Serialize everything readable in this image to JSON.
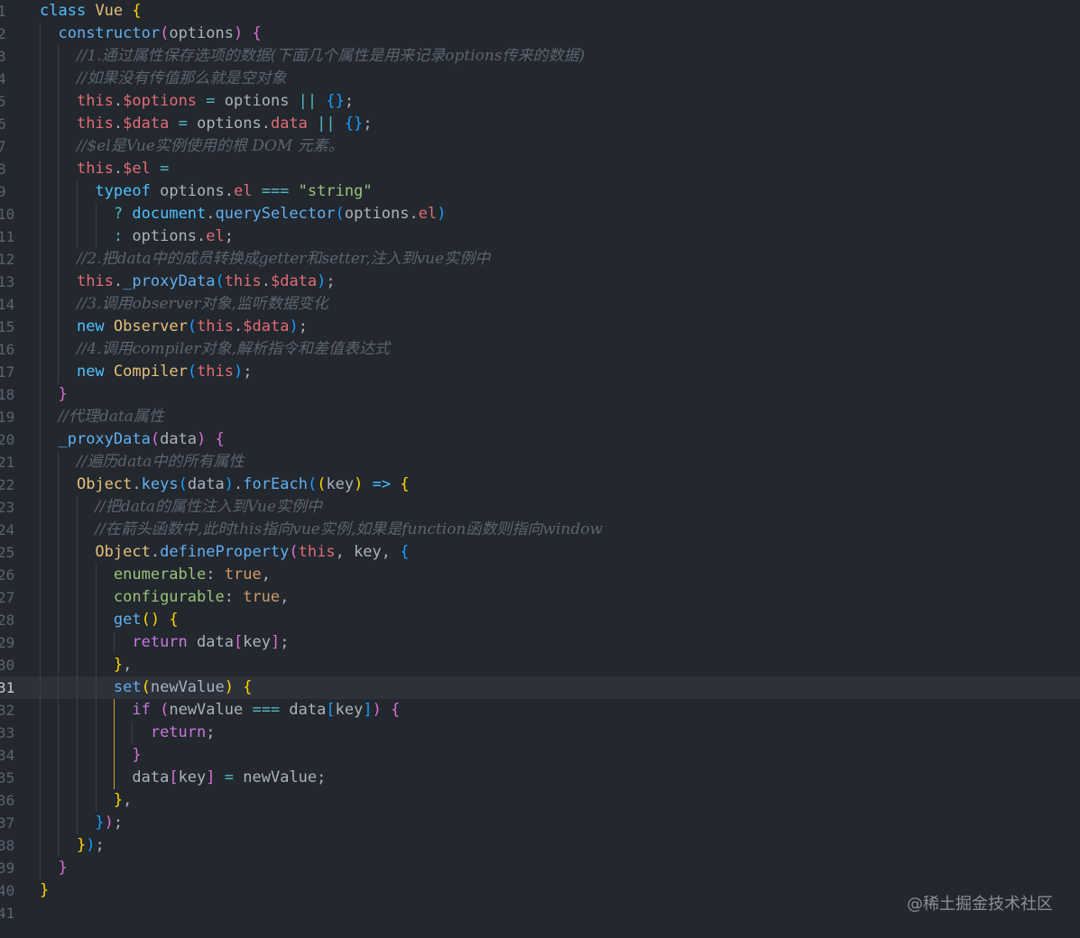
{
  "editor": {
    "line_numbers": [
      "1",
      "2",
      "3",
      "4",
      "5",
      "6",
      "7",
      "8",
      "9",
      "10",
      "11",
      "12",
      "13",
      "14",
      "15",
      "16",
      "17",
      "18",
      "19",
      "20",
      "21",
      "22",
      "23",
      "24",
      "25",
      "26",
      "27",
      "28",
      "29",
      "30",
      "31",
      "32",
      "33",
      "34",
      "35",
      "36",
      "37",
      "38",
      "39",
      "40",
      "41"
    ],
    "active_line": "31",
    "lines": [
      [
        [
          "kw",
          "class"
        ],
        [
          "pl",
          " "
        ],
        [
          "cls",
          "Vue"
        ],
        [
          "pl",
          " "
        ],
        [
          "b1",
          "{"
        ]
      ],
      [
        [
          "pl",
          "  "
        ],
        [
          "fn",
          "constructor"
        ],
        [
          "b2",
          "("
        ],
        [
          "pl",
          "options"
        ],
        [
          "b2",
          ")"
        ],
        [
          "pl",
          " "
        ],
        [
          "b2",
          "{"
        ]
      ],
      [
        [
          "pl",
          "    "
        ],
        [
          "cm",
          "//1.通过属性保存选项的数据(下面几个属性是用来记录options传来的数据)"
        ]
      ],
      [
        [
          "pl",
          "    "
        ],
        [
          "cm",
          "//如果没有传值那么就是空对象"
        ]
      ],
      [
        [
          "pl",
          "    "
        ],
        [
          "this",
          "this"
        ],
        [
          "pl",
          "."
        ],
        [
          "prop",
          "$options"
        ],
        [
          "pl",
          " "
        ],
        [
          "op",
          "="
        ],
        [
          "pl",
          " options "
        ],
        [
          "op",
          "||"
        ],
        [
          "pl",
          " "
        ],
        [
          "b3",
          "{}"
        ],
        [
          "pl",
          ";"
        ]
      ],
      [
        [
          "pl",
          "    "
        ],
        [
          "this",
          "this"
        ],
        [
          "pl",
          "."
        ],
        [
          "prop",
          "$data"
        ],
        [
          "pl",
          " "
        ],
        [
          "op",
          "="
        ],
        [
          "pl",
          " options."
        ],
        [
          "prop",
          "data"
        ],
        [
          "pl",
          " "
        ],
        [
          "op",
          "||"
        ],
        [
          "pl",
          " "
        ],
        [
          "b3",
          "{}"
        ],
        [
          "pl",
          ";"
        ]
      ],
      [
        [
          "pl",
          "    "
        ],
        [
          "cm",
          "//$el是Vue实例使用的根 DOM 元素。"
        ]
      ],
      [
        [
          "pl",
          "    "
        ],
        [
          "this",
          "this"
        ],
        [
          "pl",
          "."
        ],
        [
          "prop",
          "$el"
        ],
        [
          "pl",
          " "
        ],
        [
          "op",
          "="
        ]
      ],
      [
        [
          "pl",
          "      "
        ],
        [
          "kw",
          "typeof"
        ],
        [
          "pl",
          " options."
        ],
        [
          "prop",
          "el"
        ],
        [
          "pl",
          " "
        ],
        [
          "op",
          "==="
        ],
        [
          "pl",
          " "
        ],
        [
          "str",
          "\"string\""
        ]
      ],
      [
        [
          "pl",
          "        "
        ],
        [
          "op",
          "?"
        ],
        [
          "pl",
          " "
        ],
        [
          "kw",
          "document"
        ],
        [
          "pl",
          "."
        ],
        [
          "fn",
          "querySelector"
        ],
        [
          "b3",
          "("
        ],
        [
          "pl",
          "options."
        ],
        [
          "prop",
          "el"
        ],
        [
          "b3",
          ")"
        ]
      ],
      [
        [
          "pl",
          "        "
        ],
        [
          "op",
          ":"
        ],
        [
          "pl",
          " options."
        ],
        [
          "prop",
          "el"
        ],
        [
          "pl",
          ";"
        ]
      ],
      [
        [
          "pl",
          "    "
        ],
        [
          "cm",
          "//2.把data中的成员转换成getter和setter,注入到vue实例中"
        ]
      ],
      [
        [
          "pl",
          "    "
        ],
        [
          "this",
          "this"
        ],
        [
          "pl",
          "."
        ],
        [
          "fn",
          "_proxyData"
        ],
        [
          "b3",
          "("
        ],
        [
          "this",
          "this"
        ],
        [
          "pl",
          "."
        ],
        [
          "prop",
          "$data"
        ],
        [
          "b3",
          ")"
        ],
        [
          "pl",
          ";"
        ]
      ],
      [
        [
          "pl",
          "    "
        ],
        [
          "cm",
          "//3.调用observer对象,监听数据变化"
        ]
      ],
      [
        [
          "pl",
          "    "
        ],
        [
          "kw",
          "new"
        ],
        [
          "pl",
          " "
        ],
        [
          "cls",
          "Observer"
        ],
        [
          "b3",
          "("
        ],
        [
          "this",
          "this"
        ],
        [
          "pl",
          "."
        ],
        [
          "prop",
          "$data"
        ],
        [
          "b3",
          ")"
        ],
        [
          "pl",
          ";"
        ]
      ],
      [
        [
          "pl",
          "    "
        ],
        [
          "cm",
          "//4.调用compiler对象,解析指令和差值表达式"
        ]
      ],
      [
        [
          "pl",
          "    "
        ],
        [
          "kw",
          "new"
        ],
        [
          "pl",
          " "
        ],
        [
          "cls",
          "Compiler"
        ],
        [
          "b3",
          "("
        ],
        [
          "this",
          "this"
        ],
        [
          "b3",
          ")"
        ],
        [
          "pl",
          ";"
        ]
      ],
      [
        [
          "pl",
          "  "
        ],
        [
          "b2",
          "}"
        ]
      ],
      [
        [
          "pl",
          "  "
        ],
        [
          "cm",
          "//代理data属性"
        ]
      ],
      [
        [
          "pl",
          "  "
        ],
        [
          "fn",
          "_proxyData"
        ],
        [
          "b2",
          "("
        ],
        [
          "pl",
          "data"
        ],
        [
          "b2",
          ")"
        ],
        [
          "pl",
          " "
        ],
        [
          "b2",
          "{"
        ]
      ],
      [
        [
          "pl",
          "    "
        ],
        [
          "cm",
          "//遍历data中的所有属性"
        ]
      ],
      [
        [
          "pl",
          "    "
        ],
        [
          "cls",
          "Object"
        ],
        [
          "pl",
          "."
        ],
        [
          "fn",
          "keys"
        ],
        [
          "b3",
          "("
        ],
        [
          "pl",
          "data"
        ],
        [
          "b3",
          ")"
        ],
        [
          "pl",
          "."
        ],
        [
          "fn",
          "forEach"
        ],
        [
          "b3",
          "("
        ],
        [
          "b1",
          "("
        ],
        [
          "pl",
          "key"
        ],
        [
          "b1",
          ")"
        ],
        [
          "pl",
          " "
        ],
        [
          "kw",
          "=>"
        ],
        [
          "pl",
          " "
        ],
        [
          "b1",
          "{"
        ]
      ],
      [
        [
          "pl",
          "      "
        ],
        [
          "cm",
          "//把data的属性注入到Vue实例中"
        ]
      ],
      [
        [
          "pl",
          "      "
        ],
        [
          "cm",
          "//在箭头函数中,此时this指向vue实例,如果是function函数则指向window"
        ]
      ],
      [
        [
          "pl",
          "      "
        ],
        [
          "cls",
          "Object"
        ],
        [
          "pl",
          "."
        ],
        [
          "fn",
          "defineProperty"
        ],
        [
          "b2",
          "("
        ],
        [
          "this",
          "this"
        ],
        [
          "pl",
          ", key, "
        ],
        [
          "b3",
          "{"
        ]
      ],
      [
        [
          "pl",
          "        "
        ],
        [
          "key",
          "enumerable"
        ],
        [
          "pl",
          ": "
        ],
        [
          "bool",
          "true"
        ],
        [
          "pl",
          ","
        ]
      ],
      [
        [
          "pl",
          "        "
        ],
        [
          "key",
          "configurable"
        ],
        [
          "pl",
          ": "
        ],
        [
          "bool",
          "true"
        ],
        [
          "pl",
          ","
        ]
      ],
      [
        [
          "pl",
          "        "
        ],
        [
          "fn",
          "get"
        ],
        [
          "b1",
          "()"
        ],
        [
          "pl",
          " "
        ],
        [
          "b1",
          "{"
        ]
      ],
      [
        [
          "pl",
          "          "
        ],
        [
          "kp",
          "return"
        ],
        [
          "pl",
          " data"
        ],
        [
          "b2",
          "["
        ],
        [
          "pl",
          "key"
        ],
        [
          "b2",
          "]"
        ],
        [
          "pl",
          ";"
        ]
      ],
      [
        [
          "pl",
          "        "
        ],
        [
          "b1",
          "}"
        ],
        [
          "pl",
          ","
        ]
      ],
      [
        [
          "pl",
          "        "
        ],
        [
          "fn",
          "set"
        ],
        [
          "b1",
          "("
        ],
        [
          "pl",
          "newValue"
        ],
        [
          "b1",
          ")"
        ],
        [
          "pl",
          " "
        ],
        [
          "b1",
          "{"
        ]
      ],
      [
        [
          "pl",
          "          "
        ],
        [
          "kp",
          "if"
        ],
        [
          "pl",
          " "
        ],
        [
          "b2",
          "("
        ],
        [
          "pl",
          "newValue "
        ],
        [
          "op",
          "==="
        ],
        [
          "pl",
          " data"
        ],
        [
          "b3",
          "["
        ],
        [
          "pl",
          "key"
        ],
        [
          "b3",
          "]"
        ],
        [
          "b2",
          ")"
        ],
        [
          "pl",
          " "
        ],
        [
          "b2",
          "{"
        ]
      ],
      [
        [
          "pl",
          "            "
        ],
        [
          "kp",
          "return"
        ],
        [
          "pl",
          ";"
        ]
      ],
      [
        [
          "pl",
          "          "
        ],
        [
          "b2",
          "}"
        ]
      ],
      [
        [
          "pl",
          "          "
        ],
        [
          "pl",
          "data"
        ],
        [
          "b2",
          "["
        ],
        [
          "pl",
          "key"
        ],
        [
          "b2",
          "]"
        ],
        [
          "pl",
          " "
        ],
        [
          "op",
          "="
        ],
        [
          "pl",
          " newValue;"
        ]
      ],
      [
        [
          "pl",
          "        "
        ],
        [
          "b1",
          "}"
        ],
        [
          "pl",
          ","
        ]
      ],
      [
        [
          "pl",
          "      "
        ],
        [
          "b3",
          "}"
        ],
        [
          "b2",
          ")"
        ],
        [
          "pl",
          ";"
        ]
      ],
      [
        [
          "pl",
          "    "
        ],
        [
          "b1",
          "}"
        ],
        [
          "b3",
          ")"
        ],
        [
          "pl",
          ";"
        ]
      ],
      [
        [
          "pl",
          "  "
        ],
        [
          "b2",
          "}"
        ]
      ],
      [
        [
          "b1",
          "}"
        ]
      ],
      []
    ]
  },
  "watermark": "@稀土掘金技术社区"
}
